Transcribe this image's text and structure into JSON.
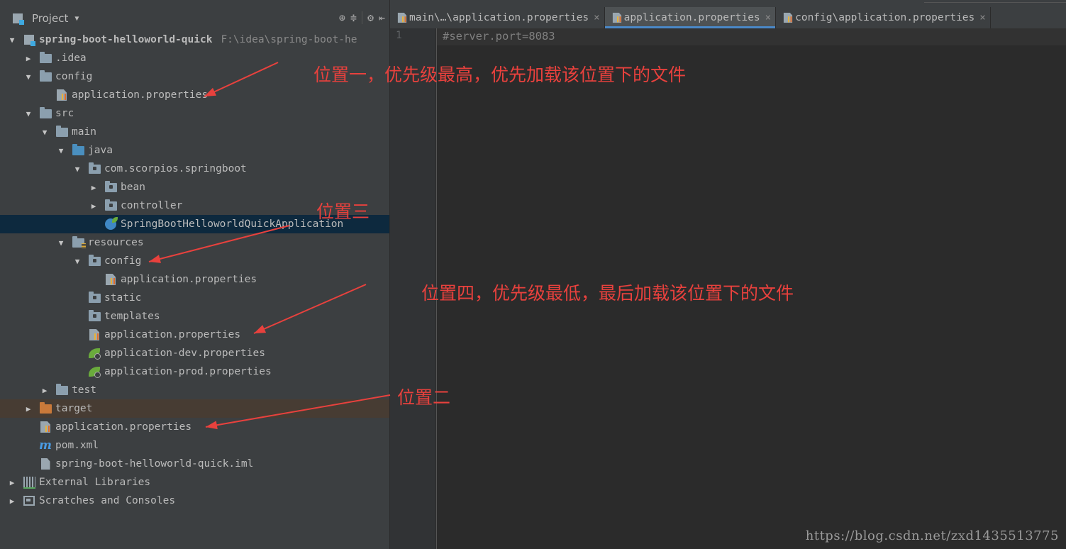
{
  "panel": {
    "title": "Project",
    "tools": [
      "target-icon",
      "collapse-icon",
      "gear-icon",
      "hide-icon"
    ]
  },
  "tree": [
    {
      "label": "spring-boot-helloworld-quick",
      "path": "F:\\idea\\spring-boot-he",
      "icon": "project-icon",
      "arrow": "down",
      "level": 0,
      "bold": true
    },
    {
      "label": ".idea",
      "icon": "folder-icon",
      "arrow": "right",
      "level": 1
    },
    {
      "label": "config",
      "icon": "folder-icon",
      "arrow": "down",
      "level": 1
    },
    {
      "label": "application.properties",
      "icon": "properties-file-icon",
      "arrow": "none",
      "level": 2
    },
    {
      "label": "src",
      "icon": "folder-icon",
      "arrow": "down",
      "level": 1
    },
    {
      "label": "main",
      "icon": "folder-icon",
      "arrow": "down",
      "level": 2
    },
    {
      "label": "java",
      "icon": "source-folder-icon",
      "arrow": "down",
      "level": 3
    },
    {
      "label": "com.scorpios.springboot",
      "icon": "package-icon",
      "arrow": "down",
      "level": 4
    },
    {
      "label": "bean",
      "icon": "package-icon",
      "arrow": "right",
      "level": 5
    },
    {
      "label": "controller",
      "icon": "package-icon",
      "arrow": "right",
      "level": 5
    },
    {
      "label": "SpringBootHelloworldQuickApplication",
      "icon": "spring-app-icon",
      "arrow": "none",
      "level": 5,
      "selected": true
    },
    {
      "label": "resources",
      "icon": "resources-folder-icon",
      "arrow": "down",
      "level": 3
    },
    {
      "label": "config",
      "icon": "package-icon",
      "arrow": "down",
      "level": 4
    },
    {
      "label": "application.properties",
      "icon": "properties-file-icon",
      "arrow": "none",
      "level": 5
    },
    {
      "label": "static",
      "icon": "package-icon",
      "arrow": "none",
      "level": 4
    },
    {
      "label": "templates",
      "icon": "package-icon",
      "arrow": "none",
      "level": 4
    },
    {
      "label": "application.properties",
      "icon": "properties-file-icon",
      "arrow": "none",
      "level": 4
    },
    {
      "label": "application-dev.properties",
      "icon": "spring-config-icon",
      "arrow": "none",
      "level": 4
    },
    {
      "label": "application-prod.properties",
      "icon": "spring-config-icon",
      "arrow": "none",
      "level": 4
    },
    {
      "label": "test",
      "icon": "folder-icon",
      "arrow": "right",
      "level": 2
    },
    {
      "label": "target",
      "icon": "excluded-folder-icon",
      "arrow": "right",
      "level": 1,
      "excluded": true
    },
    {
      "label": "application.properties",
      "icon": "properties-file-icon",
      "arrow": "none",
      "level": 1
    },
    {
      "label": "pom.xml",
      "icon": "maven-icon",
      "arrow": "none",
      "level": 1
    },
    {
      "label": "spring-boot-helloworld-quick.iml",
      "icon": "iml-file-icon",
      "arrow": "none",
      "level": 1
    },
    {
      "label": "External Libraries",
      "icon": "libraries-icon",
      "arrow": "right",
      "level": 0
    },
    {
      "label": "Scratches and Consoles",
      "icon": "scratches-icon",
      "arrow": "right",
      "level": 0
    }
  ],
  "tabs": [
    {
      "label": "main\\…\\application.properties",
      "active": false
    },
    {
      "label": "application.properties",
      "active": true
    },
    {
      "label": "config\\application.properties",
      "active": false
    }
  ],
  "editor": {
    "line_number": "1",
    "code": "#server.port=8083"
  },
  "annotations": {
    "note1": "位置一，优先级最高，优先加载该位置下的文件",
    "note2": "位置二",
    "note3": "位置三",
    "note4": "位置四，优先级最低，最后加载该位置下的文件",
    "arrow_color": "#e8413d"
  },
  "watermark": "https://blog.csdn.net/zxd1435513775"
}
